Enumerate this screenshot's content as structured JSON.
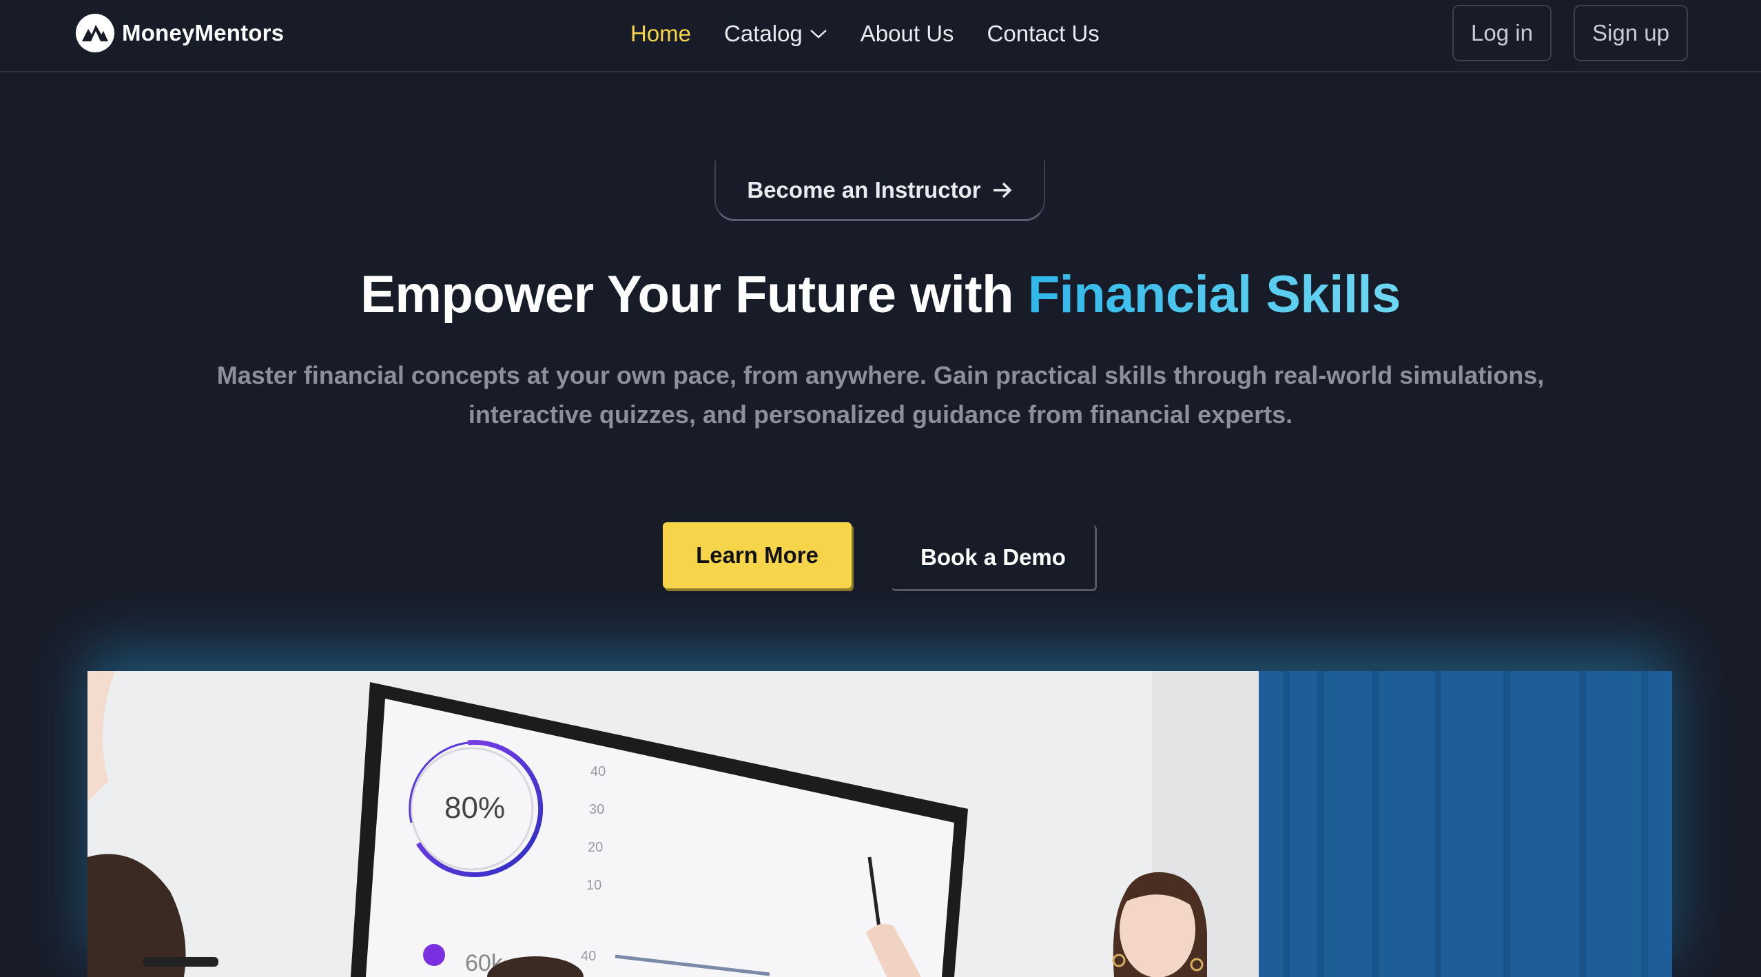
{
  "brand": {
    "name": "MoneyMentors",
    "logo_icon": "mountain-logo-icon"
  },
  "nav": {
    "links": [
      {
        "label": "Home",
        "active": true
      },
      {
        "label": "Catalog",
        "has_dropdown": true
      },
      {
        "label": "About Us"
      },
      {
        "label": "Contact Us"
      }
    ],
    "login_label": "Log in",
    "signup_label": "Sign up"
  },
  "hero": {
    "pill_label": "Become an Instructor",
    "pill_icon": "arrow-right-icon",
    "headline_plain": "Empower Your Future with ",
    "headline_accent": "Financial Skills",
    "subtext_line1": "Master financial concepts at your own pace, from anywhere. Gain practical skills through real-world simulations,",
    "subtext_line2": "interactive quizzes, and personalized guidance from financial experts.",
    "primary_cta": "Learn More",
    "secondary_cta": "Book a Demo"
  },
  "hero_image": {
    "gauge_label": "80%",
    "axis_labels": [
      "40",
      "30",
      "20",
      "10"
    ],
    "bottom_axis_label": "40",
    "stat_label": "60k"
  },
  "colors": {
    "background": "#181c28",
    "accent_yellow": "#f7d54a",
    "accent_cyan": "#2fb8ea",
    "muted_text": "#8b909c"
  }
}
